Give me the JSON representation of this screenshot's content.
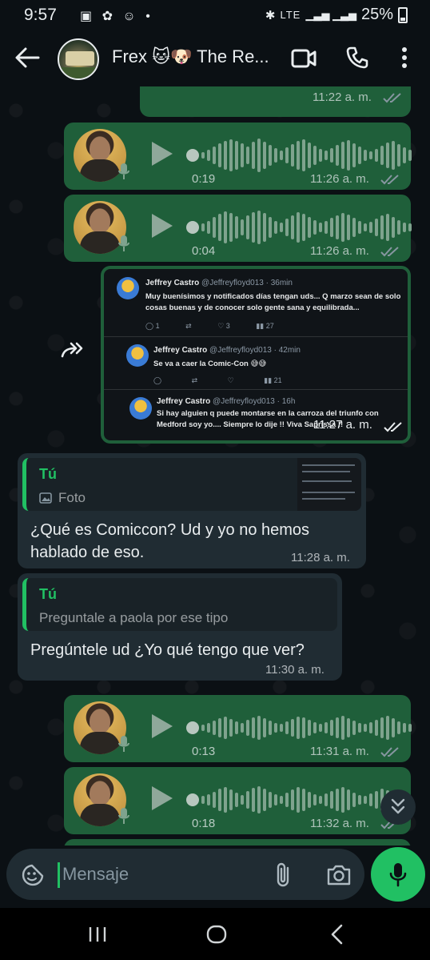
{
  "status_bar": {
    "time": "9:57",
    "left_icons": "▣ ✿ ☺ •",
    "network": "LTE",
    "battery": "25%"
  },
  "header": {
    "title": "Frex 🐱🐶 The Re...",
    "icons": [
      "back-arrow-icon",
      "video-call-icon",
      "phone-call-icon",
      "more-options-icon"
    ]
  },
  "messages": {
    "top_partial": {
      "time": "11:22 a. m."
    },
    "voice1": {
      "duration": "0:19",
      "time": "11:26 a. m."
    },
    "voice2": {
      "duration": "0:04",
      "time": "11:26 a. m."
    },
    "image": {
      "time": "11:27 a. m.",
      "tweets": [
        {
          "name": "Jeffrey Castro",
          "handle": "@Jeffreyfloyd013 · 36min",
          "text": "Muy buenísimos y notificados días tengan uds... Q marzo sean de solo cosas buenas y de conocer solo gente sana y equilibrada...",
          "actions": [
            "1",
            "",
            "3",
            "27"
          ]
        },
        {
          "name": "Jeffrey Castro",
          "handle": "@Jeffreyfloyd013 · 42min",
          "text": "Se va a caer la Comic-Con 😅😅",
          "actions": [
            "",
            "",
            "",
            "21"
          ]
        },
        {
          "name": "Jeffrey Castro",
          "handle": "@Jeffreyfloyd013 · 16h",
          "text": "Si hay alguien q puede montarse en la carroza del triunfo con Medford soy yo.... Siempre lo dije !! Viva Saprissa !!",
          "actions": []
        }
      ]
    },
    "reply1": {
      "quote_name": "Tú",
      "quote_text": "Foto",
      "text_line1": "¿Qué es Comiccon? Ud y yo no hemos",
      "text_line2": "hablado de eso.",
      "time": "11:28 a. m."
    },
    "reply2": {
      "quote_name": "Tú",
      "quote_text": "Preguntale a paola por ese tipo",
      "text": "Pregúntele ud ¿Yo qué tengo que ver?",
      "time": "11:30 a. m."
    },
    "voice3": {
      "duration": "0:13",
      "time": "11:31 a. m."
    },
    "voice4": {
      "duration": "0:18",
      "time": "11:32 a. m."
    }
  },
  "input": {
    "placeholder": "Mensaje"
  },
  "colors": {
    "outgoing_bubble": "#1f5f3a",
    "incoming_bubble": "#202c33",
    "accent": "#21c063",
    "background": "#0b1014"
  }
}
